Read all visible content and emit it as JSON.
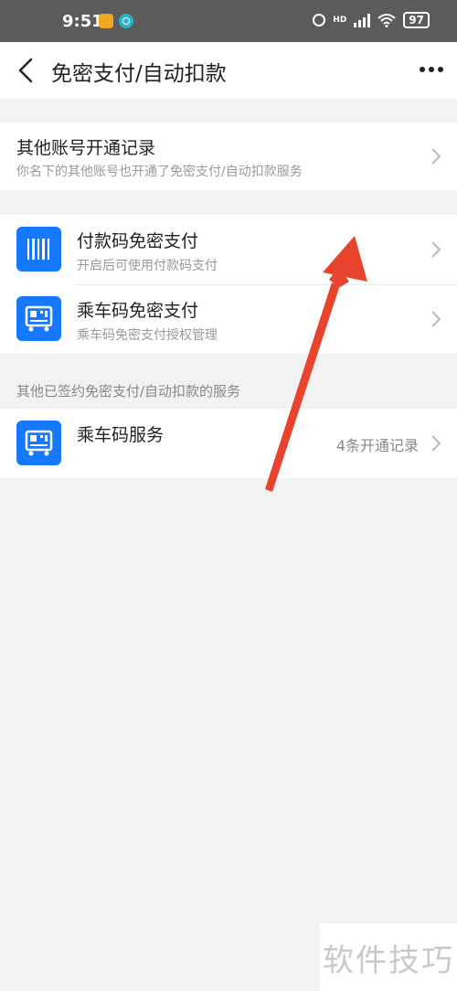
{
  "status_bar": {
    "time": "9:51",
    "battery": "97",
    "hd_label": "HD"
  },
  "nav": {
    "title": "免密支付/自动扣款"
  },
  "other_accounts": {
    "title": "其他账号开通记录",
    "subtitle": "你名下的其他账号也开通了免密支付/自动扣款服务"
  },
  "services": [
    {
      "title": "付款码免密支付",
      "subtitle": "开启后可使用付款码支付",
      "icon": "barcode-icon"
    },
    {
      "title": "乘车码免密支付",
      "subtitle": "乘车码免密支付授权管理",
      "icon": "bus-code-icon"
    }
  ],
  "signed_section": {
    "label": "其他已签约免密支付/自动扣款的服务",
    "items": [
      {
        "title": "乘车码服务",
        "right_text": "4条开通记录",
        "icon": "bus-code-icon"
      }
    ]
  },
  "watermark": "软件技巧",
  "colors": {
    "accent": "#1677ff",
    "annotation_arrow": "#e8432d",
    "status_bar": "#5b5b5b"
  }
}
